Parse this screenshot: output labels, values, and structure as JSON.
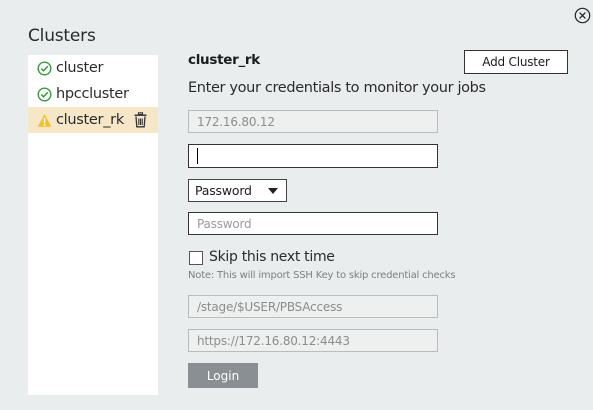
{
  "dialog": {
    "close_icon": "close-circle-icon"
  },
  "clusters": {
    "title": "Clusters",
    "items": [
      {
        "label": "cluster",
        "status": "ok",
        "status_icon": "check-circle-icon",
        "status_color": "#3a9a3a"
      },
      {
        "label": "hpccluster",
        "status": "ok",
        "status_icon": "check-circle-icon",
        "status_color": "#3a9a3a"
      },
      {
        "label": "cluster_rk",
        "status": "warning",
        "status_icon": "warning-triangle-icon",
        "status_color": "#f2c12e",
        "selected": true,
        "delete_icon": "trash-icon"
      }
    ]
  },
  "details": {
    "title": "cluster_rk",
    "add_cluster_label": "Add Cluster",
    "instructions": "Enter your credentials to monitor your jobs",
    "host_value": "172.16.80.12",
    "username_value": "",
    "auth_method": "Password",
    "password_placeholder": "Password",
    "skip_label": "Skip this next time",
    "skip_checked": false,
    "note": "Note: This will import SSH Key to skip credential checks",
    "path_value": "/stage/$USER/PBSAccess",
    "url_value": "https://172.16.80.12:4443",
    "login_label": "Login"
  },
  "colors": {
    "background": "#e9eded",
    "selected_row": "#f5e7c8",
    "login_button": "#8a8f93"
  }
}
